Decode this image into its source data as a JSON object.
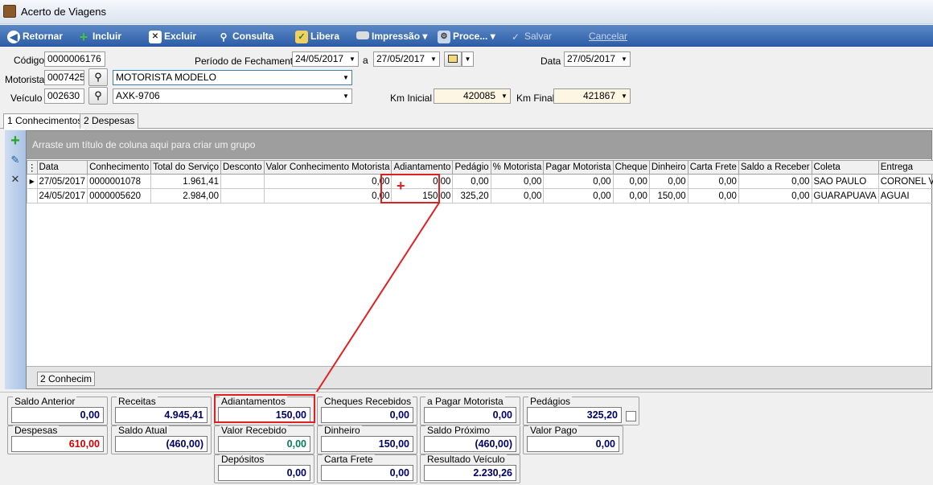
{
  "window": {
    "title": "Acerto de Viagens",
    "icon": "briefcase-icon"
  },
  "toolbar": {
    "retornar": "Retornar",
    "incluir": "Incluir",
    "excluir": "Excluir",
    "consulta": "Consulta",
    "libera": "Libera",
    "impressao": "Impressão",
    "processar": "Proce...",
    "salvar": "Salvar",
    "cancelar": "Cancelar"
  },
  "form": {
    "codigo_label": "Código",
    "codigo": "0000006176",
    "periodo_label": "Período de Fechamento",
    "periodo_inicio": "24/05/2017",
    "periodo_sep": "a",
    "periodo_fim": "27/05/2017",
    "data_label": "Data",
    "data": "27/05/2017",
    "motorista_label": "Motorista",
    "motorista_codigo": "0007425",
    "motorista_nome": "MOTORISTA MODELO",
    "veiculo_label": "Veículo",
    "veiculo_codigo": "002630",
    "veiculo_placa": "AXK-9706",
    "km_inicial_label": "Km Inicial",
    "km_inicial": "420085",
    "km_final_label": "Km Final",
    "km_final": "421867"
  },
  "tabs": [
    {
      "label": "1 Conhecimentos"
    },
    {
      "label": "2 Despesas"
    }
  ],
  "grid": {
    "group_hint": "Arraste um título de coluna aqui para criar um grupo",
    "columns": [
      "Data",
      "Conhecimento",
      "Total do Serviço",
      "Desconto",
      "Valor Conhecimento Motorista",
      "Adiantamento",
      "Pedágio",
      "% Motorista",
      "Pagar Motorista",
      "Cheque",
      "Dinheiro",
      "Carta Frete",
      "Saldo a Receber",
      "Coleta",
      "Entrega"
    ],
    "rows": [
      [
        "27/05/2017",
        "0000001078",
        "1.961,41",
        "",
        "0,00",
        "0,00",
        "0,00",
        "0,00",
        "0,00",
        "0,00",
        "0,00",
        "0,00",
        "0,00",
        "SAO PAULO",
        "CORONEL VIVIDA"
      ],
      [
        "24/05/2017",
        "0000005620",
        "2.984,00",
        "",
        "0,00",
        "150,00",
        "325,20",
        "0,00",
        "0,00",
        "0,00",
        "150,00",
        "0,00",
        "0,00",
        "GUARAPUAVA",
        "AGUAI"
      ]
    ],
    "footer_count": "2 Conhecim"
  },
  "summary": {
    "saldo_anterior": {
      "label": "Saldo Anterior",
      "value": "0,00"
    },
    "receitas": {
      "label": "Receitas",
      "value": "4.945,41"
    },
    "adiantamentos": {
      "label": "Adiantamentos",
      "value": "150,00"
    },
    "cheques_recebidos": {
      "label": "Cheques Recebidos",
      "value": "0,00"
    },
    "a_pagar_motorista": {
      "label": "a Pagar Motorista",
      "value": "0,00"
    },
    "pedagios": {
      "label": "Pedágios",
      "value": "325,20"
    },
    "despesas": {
      "label": "Despesas",
      "value": "610,00"
    },
    "saldo_atual": {
      "label": "Saldo Atual",
      "value": "(460,00)"
    },
    "valor_recebido": {
      "label": "Valor Recebido",
      "value": "0,00"
    },
    "dinheiro": {
      "label": "Dinheiro",
      "value": "150,00"
    },
    "saldo_proximo": {
      "label": "Saldo Próximo Acerto",
      "value": "(460,00)"
    },
    "valor_pago": {
      "label": "Valor Pago",
      "value": "0,00"
    },
    "depositos": {
      "label": "Depósitos",
      "value": "0,00"
    },
    "carta_frete": {
      "label": "Carta Frete",
      "value": "0,00"
    },
    "resultado_veiculo": {
      "label": "Resultado Veículo",
      "value": "2.230,26"
    }
  },
  "colors": {
    "toolbar": "#2d5ea8",
    "annotation": "#e02020",
    "negative": "#cc0000",
    "positive_green": "#0a7a5a"
  }
}
